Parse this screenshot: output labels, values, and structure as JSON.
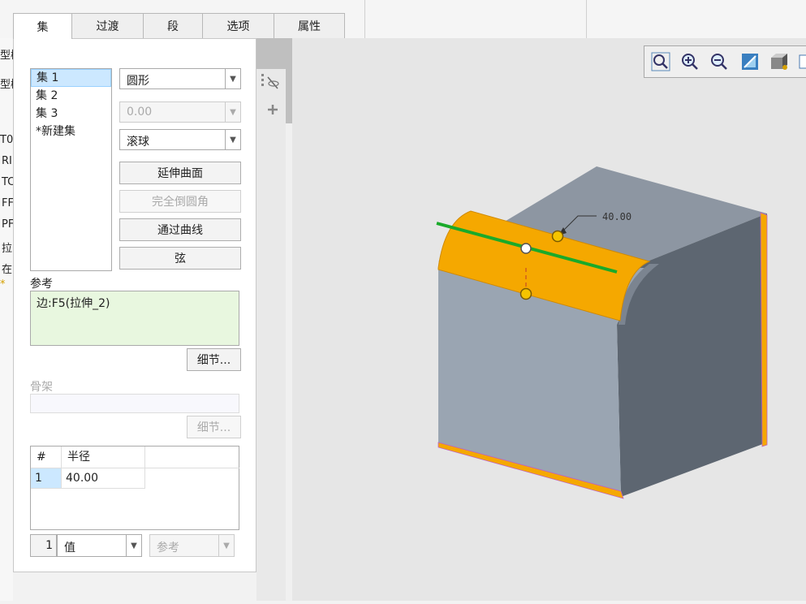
{
  "tabs": [
    "集",
    "过渡",
    "段",
    "选项",
    "属性"
  ],
  "left_tree": [
    "型树",
    "型树",
    "T0",
    "RI",
    "TC",
    "FF",
    "PF",
    "拉",
    "在",
    "*"
  ],
  "sets": {
    "items": [
      "集 1",
      "集 2",
      "集 3",
      "*新建集"
    ],
    "selected": 0
  },
  "shape_dropdown": "圆形",
  "value_dropdown": "0.00",
  "method_dropdown": "滚球",
  "buttons": {
    "extend_surface": "延伸曲面",
    "full_round": "完全倒圆角",
    "through_curve": "通过曲线",
    "chord": "弦",
    "details": "细节...",
    "details_skeleton": "细节..."
  },
  "references": {
    "label": "参考",
    "value": "边:F5(拉伸_2)"
  },
  "skeleton": {
    "label": "骨架"
  },
  "radius_table": {
    "headers": [
      "#",
      "半径"
    ],
    "rows": [
      {
        "num": "1",
        "radius": "40.00"
      }
    ]
  },
  "bottom": {
    "index": "1",
    "type_value": "值",
    "ref_value": "参考"
  },
  "dimension": "40.00",
  "colors": {
    "round_orange": "#f5a800",
    "edge_green": "#1aaa2a",
    "face_light": "#9aa5b2",
    "face_top": "#8d96a2",
    "face_dark": "#5d6671"
  },
  "toolbar_icons": [
    "zoom-fit-icon",
    "zoom-in-icon",
    "zoom-out-icon",
    "repaint-icon",
    "shading-icon",
    "saved-view-icon"
  ]
}
